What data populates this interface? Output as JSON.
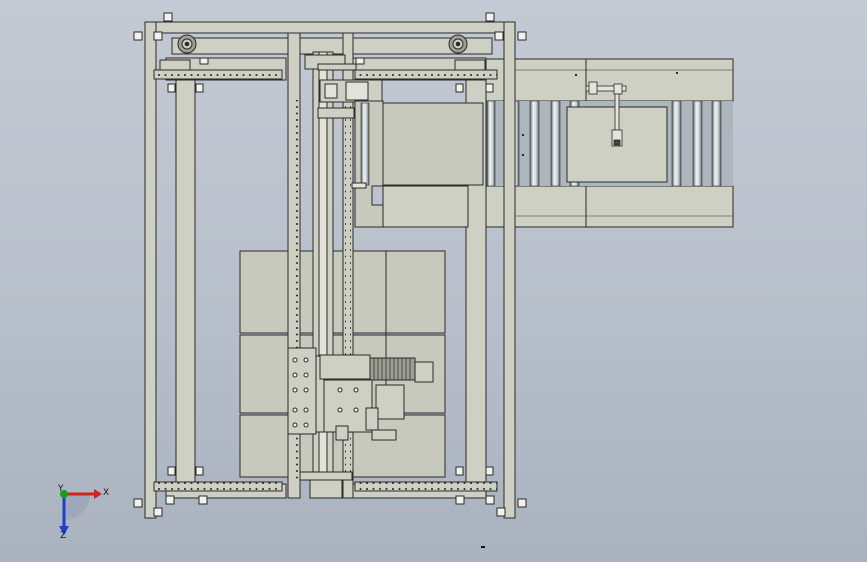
{
  "app": {
    "view": "front"
  },
  "triad": {
    "x_label": "X",
    "y_label": "Y",
    "z_label": "Z",
    "colors": {
      "x": "#d42020",
      "y": "#12a012",
      "z": "#1f3fd0",
      "origin": "#9aa6b6"
    }
  },
  "colors": {
    "background_top": "#c4cad4",
    "background_bottom": "#a9b2bf",
    "part_fill": "#cfd0c4",
    "part_stroke": "#2a2a2a",
    "roller_dark": "#6f7d86",
    "roller_light": "#e4e8e8"
  }
}
